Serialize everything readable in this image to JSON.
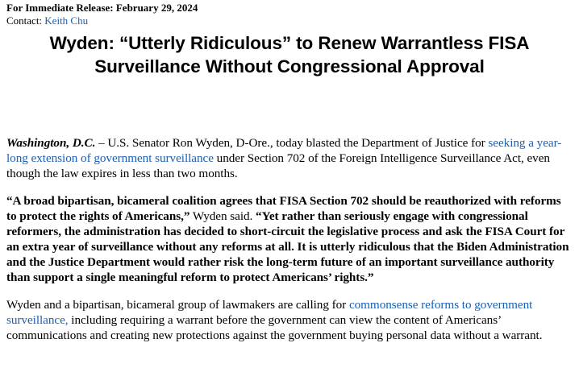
{
  "header": {
    "release_label": "For Immediate Release: February 29, 2024",
    "contact_label": "Contact:",
    "contact_name": "Keith Chu"
  },
  "headline": "Wyden: “Utterly Ridiculous” to Renew Warrantless FISA Surveillance Without Congressional Approval",
  "body": {
    "p1": {
      "dateline": "Washington, D.C.",
      "text_a": " – U.S. Senator Ron Wyden, D-Ore., today blasted the Department of Justice for ",
      "link": "seeking a year-long extension of government surveillance",
      "text_b": " under Section 702 of the Foreign Intelligence Surveillance Act, even though the law expires in less than two months."
    },
    "p2": {
      "quote_a": "“A broad bipartisan, bicameral coalition agrees that FISA Section 702 should be reauthorized with reforms to protect the rights of Americans,”",
      "said": " Wyden said. ",
      "quote_b": "“Yet rather than seriously engage with congressional reformers, the administration has decided to short-circuit the legislative process and ask the FISA Court for an extra year of surveillance without any reforms at all. It is utterly ridiculous that the Biden Administration and the Justice Department would rather risk the long-term future of an important surveillance authority than support a single meaningful reform to protect Americans’ rights.”"
    },
    "p3": {
      "text_a": "Wyden and a bipartisan, bicameral group of lawmakers are calling for ",
      "link": "commonsense reforms to government surveillance,",
      "text_b": " including requiring a warrant before the government can view the content of Americans’ communications and creating new protections against the government buying personal data without a warrant."
    }
  },
  "colors": {
    "link": "#1a5fb4",
    "text": "#000000",
    "background": "#ffffff"
  }
}
